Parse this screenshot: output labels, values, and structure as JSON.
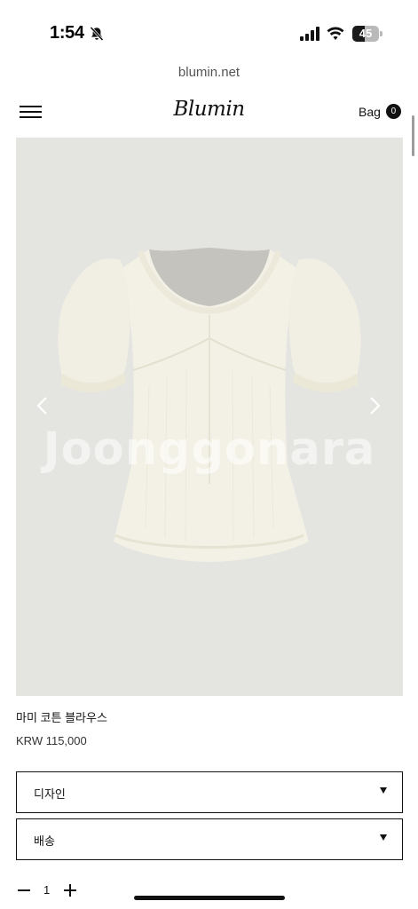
{
  "status_bar": {
    "time": "1:54",
    "battery": "45",
    "battery_level": 0.45,
    "icons": [
      "bell-slash-icon",
      "cellular-signal-icon",
      "wifi-icon",
      "battery-icon"
    ]
  },
  "browser": {
    "url": "blumin.net"
  },
  "header": {
    "logo": "Blumin",
    "bag_label": "Bag",
    "bag_count": "0",
    "menu_icon": "hamburger-menu-icon"
  },
  "gallery": {
    "watermark": "Joonggonara",
    "prev_icon": "chevron-left-icon",
    "next_icon": "chevron-right-icon",
    "background": "#e4e4e1",
    "garment_color": "#f3f1e6"
  },
  "product": {
    "name": "마미 코튼 블라우스",
    "price": "KRW 115,000"
  },
  "options": [
    {
      "label": "디자인"
    },
    {
      "label": "배송"
    }
  ],
  "quantity": {
    "value": "1",
    "minus_icon": "minus-icon",
    "plus_icon": "plus-icon"
  }
}
